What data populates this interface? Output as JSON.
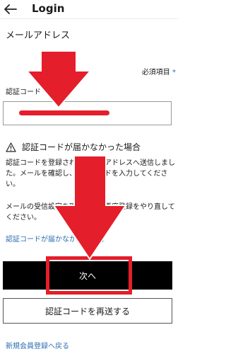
{
  "header": {
    "back_icon": "arrow-left-icon",
    "title": "Login"
  },
  "form": {
    "email_section_label": "メールアドレス",
    "required_note": "必須項目",
    "required_mark": "*",
    "code_label": "認証コード",
    "code_required_mark": "*",
    "code_value": ""
  },
  "help": {
    "warning_icon": "warning-triangle-icon",
    "title": "認証コードが届かなかった場合",
    "paragraph1": "認証コードを登録されたメールアドレスへ送信しました。メールを確認し、認証コードを入力してください。",
    "paragraph2": "メールの受信設定を確認の上、再度登録をやり直してください。",
    "link": "認証コードが届かなかった場合"
  },
  "actions": {
    "next_label": "次へ",
    "resend_label": "認証コードを再送する",
    "back_to_register": "新規会員登録へ戻る"
  },
  "overlay": {
    "accent_color": "#e41e2a"
  }
}
